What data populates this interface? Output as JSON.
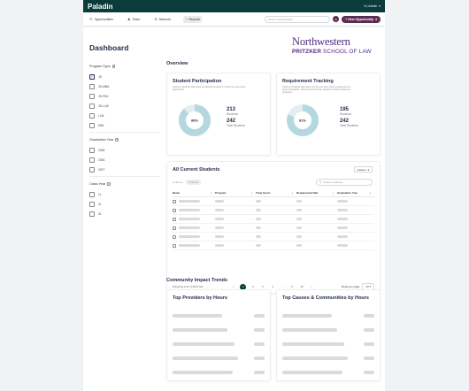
{
  "app": {
    "brand": "Paladin",
    "user": "Hi, Admin"
  },
  "nav": {
    "items": [
      {
        "label": "Opportunities",
        "icon": "opportunities-icon",
        "glyph": "☷"
      },
      {
        "label": "Team",
        "icon": "team-icon",
        "glyph": "♟"
      },
      {
        "label": "Network",
        "icon": "network-icon",
        "glyph": "✲"
      },
      {
        "label": "Reports",
        "icon": "reports-icon",
        "glyph": "◔"
      }
    ],
    "search_placeholder": "Search opportunities",
    "new_button": "+ New Opportunity"
  },
  "sidebar": {
    "title": "Dashboard",
    "program_type": {
      "label": "Program Type",
      "options": [
        {
          "label": "JD",
          "checked": true
        },
        {
          "label": "JD-MBA",
          "checked": false
        },
        {
          "label": "JD-PhD",
          "checked": false
        },
        {
          "label": "JD-LLM",
          "checked": false
        },
        {
          "label": "LLM",
          "checked": false
        },
        {
          "label": "MSL",
          "checked": false
        }
      ]
    },
    "graduation_year": {
      "label": "Graduation Year",
      "options": [
        "2025",
        "2026",
        "2027"
      ]
    },
    "class_year": {
      "label": "Class Year",
      "options": [
        "1L",
        "2L",
        "3L"
      ]
    }
  },
  "logo": {
    "main": "Northwestern",
    "sub_bold": "PRITZKER",
    "sub_rest": " SCHOOL OF LAW"
  },
  "overview": {
    "title": "Overview",
    "participation": {
      "title": "Student Participation",
      "desc": "Count of students who have contributed at least 0.1 hours to a pro bono opportunity",
      "percent": 88,
      "percent_label": "88%",
      "students": "213",
      "students_label": "Students",
      "total": "242",
      "total_label": "Total Students"
    },
    "requirement": {
      "title": "Requirement Tracking",
      "desc": "Count of students who have met the pro bono hours requirement or recommendation. This accounts for the variation of hours based on programs.",
      "percent": 81,
      "percent_label": "81%",
      "students": "195",
      "students_label": "Students",
      "total": "242",
      "total_label": "Total Students"
    }
  },
  "students_table": {
    "title": "All Current Students",
    "actions": "Actions",
    "columns_label": "Columns",
    "email_label": "Email",
    "search_placeholder": "Search students",
    "headers": [
      "Name",
      "Program",
      "Total Hours",
      "Requirement Met",
      "Graduation Year"
    ],
    "row_count": 6,
    "showing": "Showing 1-10 of 250 rows",
    "pages": [
      "<",
      "1",
      "2",
      "3",
      "4",
      "...",
      "9",
      "10",
      ">"
    ],
    "rows_per_page_label": "Rows per page",
    "rows_per_page": "10"
  },
  "community": {
    "title": "Community Impact Trends",
    "providers_title": "Top Providers by Hours",
    "causes_title": "Top Causes & Communities by Hours"
  },
  "colors": {
    "donut_fill": "#b5d8e0",
    "donut_track": "#e4eef1",
    "brand": "#0c3b3c",
    "accent": "#5a2d52"
  }
}
